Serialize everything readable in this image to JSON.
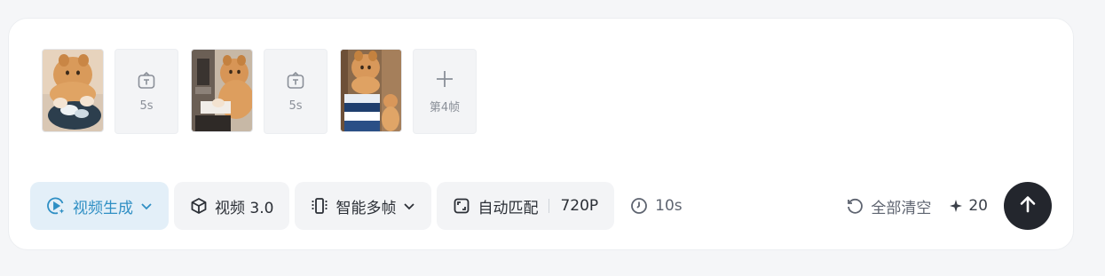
{
  "frames": {
    "items": [
      {
        "type": "image",
        "alt": "frame-1"
      },
      {
        "type": "transition",
        "label": "5s"
      },
      {
        "type": "image",
        "alt": "frame-2"
      },
      {
        "type": "transition",
        "label": "5s"
      },
      {
        "type": "image",
        "alt": "frame-3"
      }
    ],
    "add_label": "第4帧"
  },
  "toolbar": {
    "mode_label": "视频生成",
    "model_label": "视频 3.0",
    "frames_mode_label": "智能多帧",
    "ratio_label": "自动匹配",
    "resolution_label": "720P",
    "duration_label": "10s"
  },
  "actions": {
    "clear_label": "全部清空",
    "credits_value": "20"
  },
  "colors": {
    "accent": "#2f8fc4",
    "accent_bg": "#e3eff8",
    "send_bg": "#23262d"
  }
}
